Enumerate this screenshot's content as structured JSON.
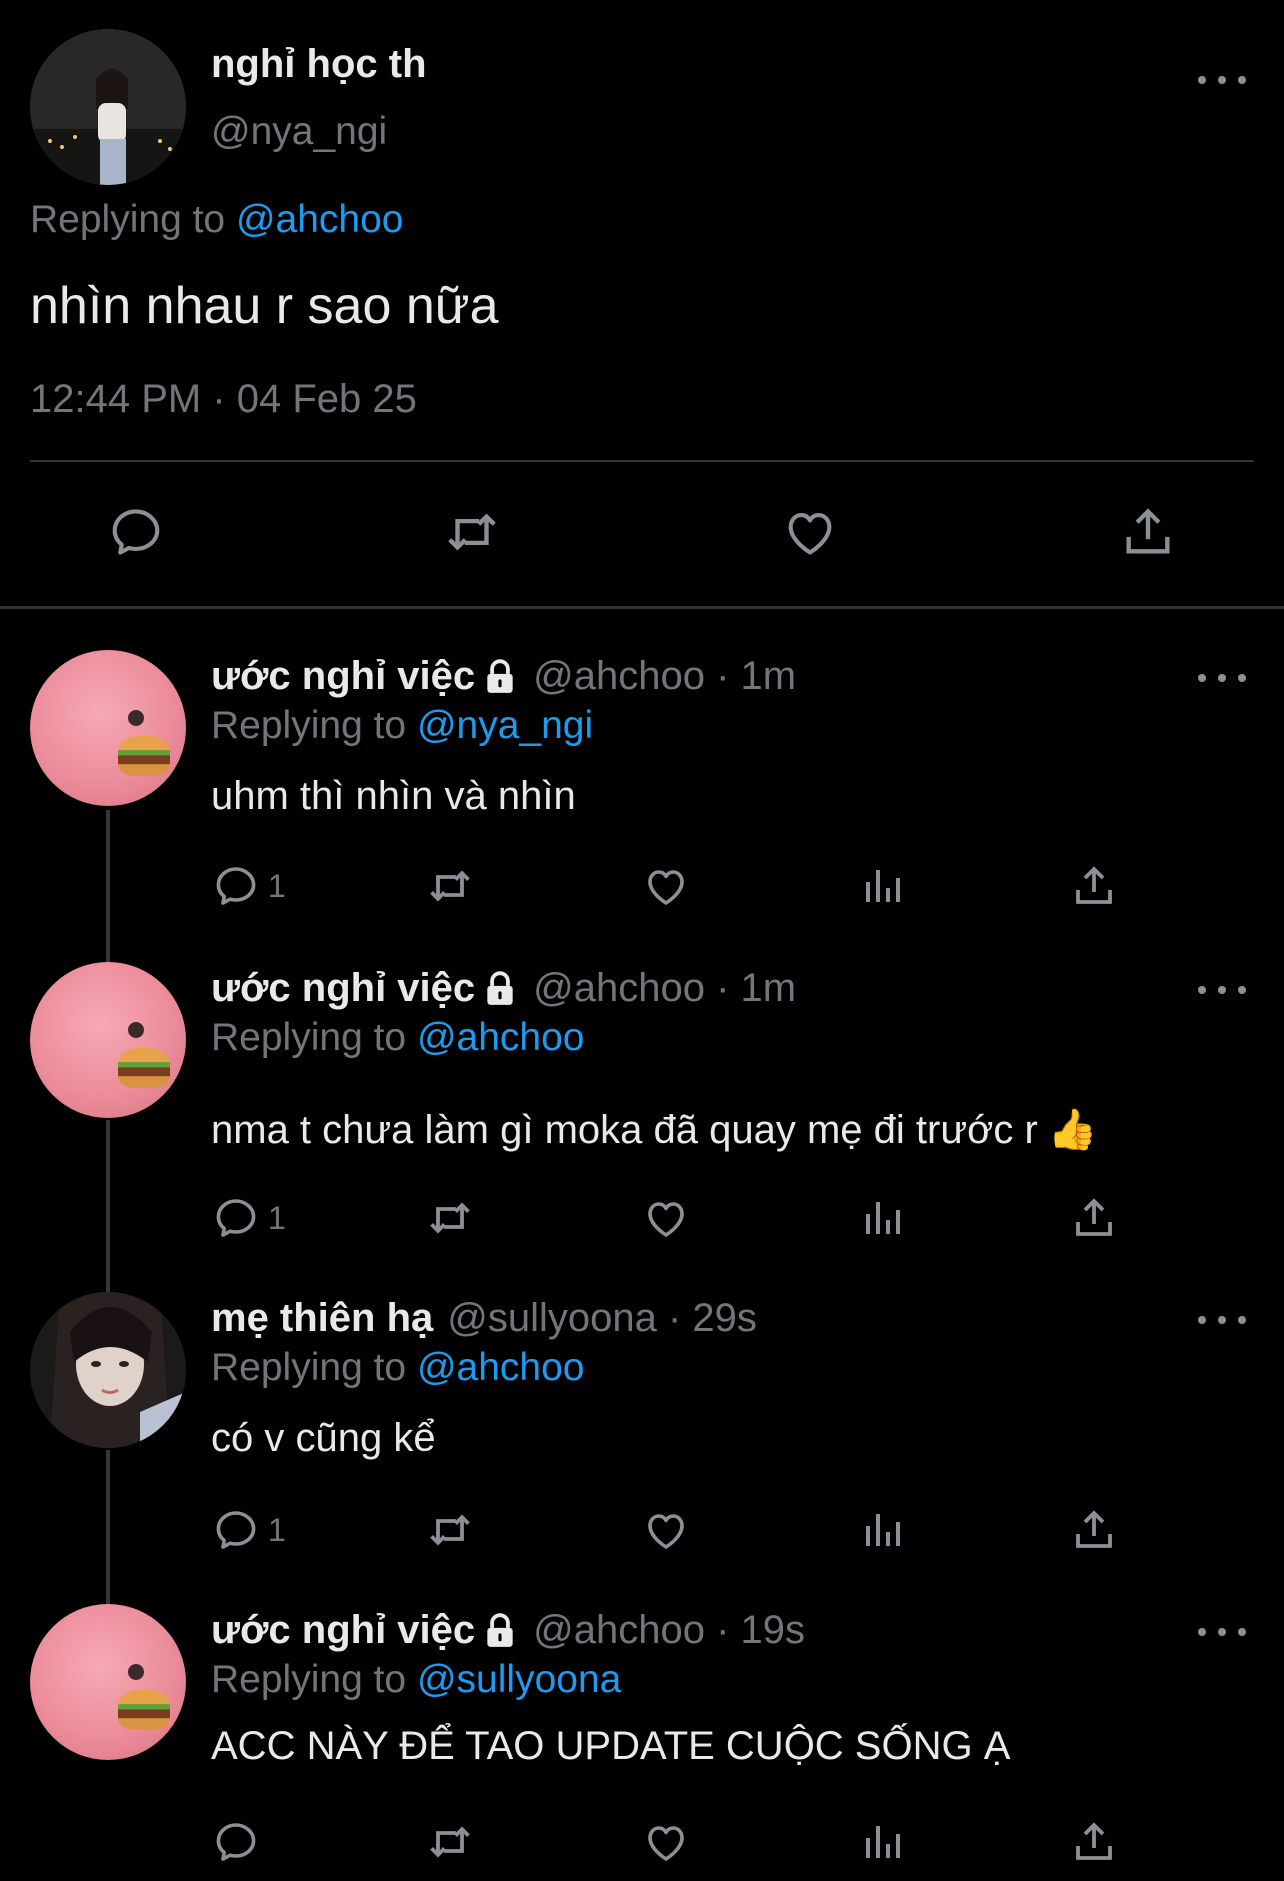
{
  "main_tweet": {
    "display_name": "nghỉ học th",
    "handle": "@nya_ngi",
    "replying_prefix": "Replying to ",
    "replying_to": "@ahchoo",
    "text": "nhìn nhau r sao nữa",
    "timestamp": "12:44 PM · 04 Feb 25",
    "actions": [
      "reply-icon",
      "retweet-icon",
      "like-icon",
      "share-icon"
    ]
  },
  "replies": [
    {
      "display_name": "ước nghỉ việc",
      "locked": true,
      "handle_time": "@ahchoo · 1m",
      "replying_prefix": "Replying to ",
      "replying_to": "@nya_ngi",
      "text": "uhm thì nhìn và nhìn",
      "reply_count": "1"
    },
    {
      "display_name": "ước nghỉ việc",
      "locked": true,
      "handle_time": "@ahchoo · 1m",
      "replying_prefix": "Replying to ",
      "replying_to": "@ahchoo",
      "text": "nma t chưa làm gì moka đã quay mẹ đi trước r",
      "emoji": "👍",
      "reply_count": "1"
    },
    {
      "display_name": "mẹ thiên hạ",
      "locked": false,
      "handle_time": "@sullyoona · 29s",
      "replying_prefix": "Replying to ",
      "replying_to": "@ahchoo",
      "text": "có v cũng kể",
      "reply_count": "1"
    },
    {
      "display_name": "ước nghỉ việc",
      "locked": true,
      "handle_time": "@ahchoo · 19s",
      "replying_prefix": "Replying to ",
      "replying_to": "@sullyoona",
      "text": "ACC NÀY ĐỂ TAO UPDATE CUỘC SỐNG Ạ",
      "reply_count": ""
    }
  ],
  "colors": {
    "background": "#000000",
    "text_primary": "#e7e9ea",
    "text_secondary": "#71767b",
    "link": "#1d9bf0",
    "divider": "#2f3336"
  }
}
